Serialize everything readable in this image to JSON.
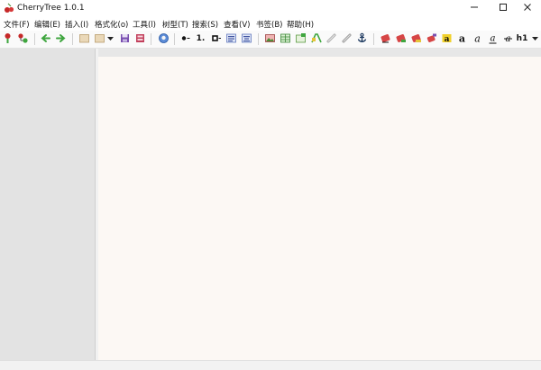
{
  "window": {
    "title": "CherryTree 1.0.1",
    "icons": [
      "cherry-icon",
      "minimize-icon",
      "maximize-icon",
      "close-icon"
    ]
  },
  "menu": [
    {
      "label": "文件(F)"
    },
    {
      "label": "编辑(E)"
    },
    {
      "label": "插入(I)"
    },
    {
      "label": "格式化(o)"
    },
    {
      "label": "工具(l)"
    },
    {
      "label": "树型(T)"
    },
    {
      "label": "搜索(S)"
    },
    {
      "label": "查看(V)"
    },
    {
      "label": "书签(B)"
    },
    {
      "label": "帮助(H)"
    }
  ],
  "toolbar": {
    "numbered_list_label": "1.",
    "h1_label": "h1",
    "icons": [
      "add-node-icon",
      "add-subnode-icon",
      "go-back-icon",
      "go-forward-icon",
      "new-file-icon",
      "open-file-icon",
      "recent-files-dropdown-icon",
      "save-icon",
      "export-icon",
      "find-in-nodes-icon",
      "bulleted-list-icon",
      "numbered-list-icon",
      "todo-list-icon",
      "toggle-panel-icon",
      "align-icon",
      "insert-image-icon",
      "insert-table-icon",
      "insert-codebox-icon",
      "insert-special-char-icon",
      "insert-link-icon",
      "link-node-icon",
      "insert-anchor-icon",
      "text-color-icon",
      "background-color-icon",
      "clear-format-icon",
      "subscript-icon",
      "highlight-icon",
      "bold-icon",
      "italic-icon",
      "underline-icon",
      "strikethrough-icon",
      "heading-1-icon",
      "more-dropdown-icon"
    ]
  },
  "colors": {
    "tree_pane": "#e3e3e3",
    "editor_background": "#fcf8f4",
    "accent_red": "#d64545",
    "accent_green": "#3fa63f",
    "accent_yellow": "#e5c53a"
  }
}
